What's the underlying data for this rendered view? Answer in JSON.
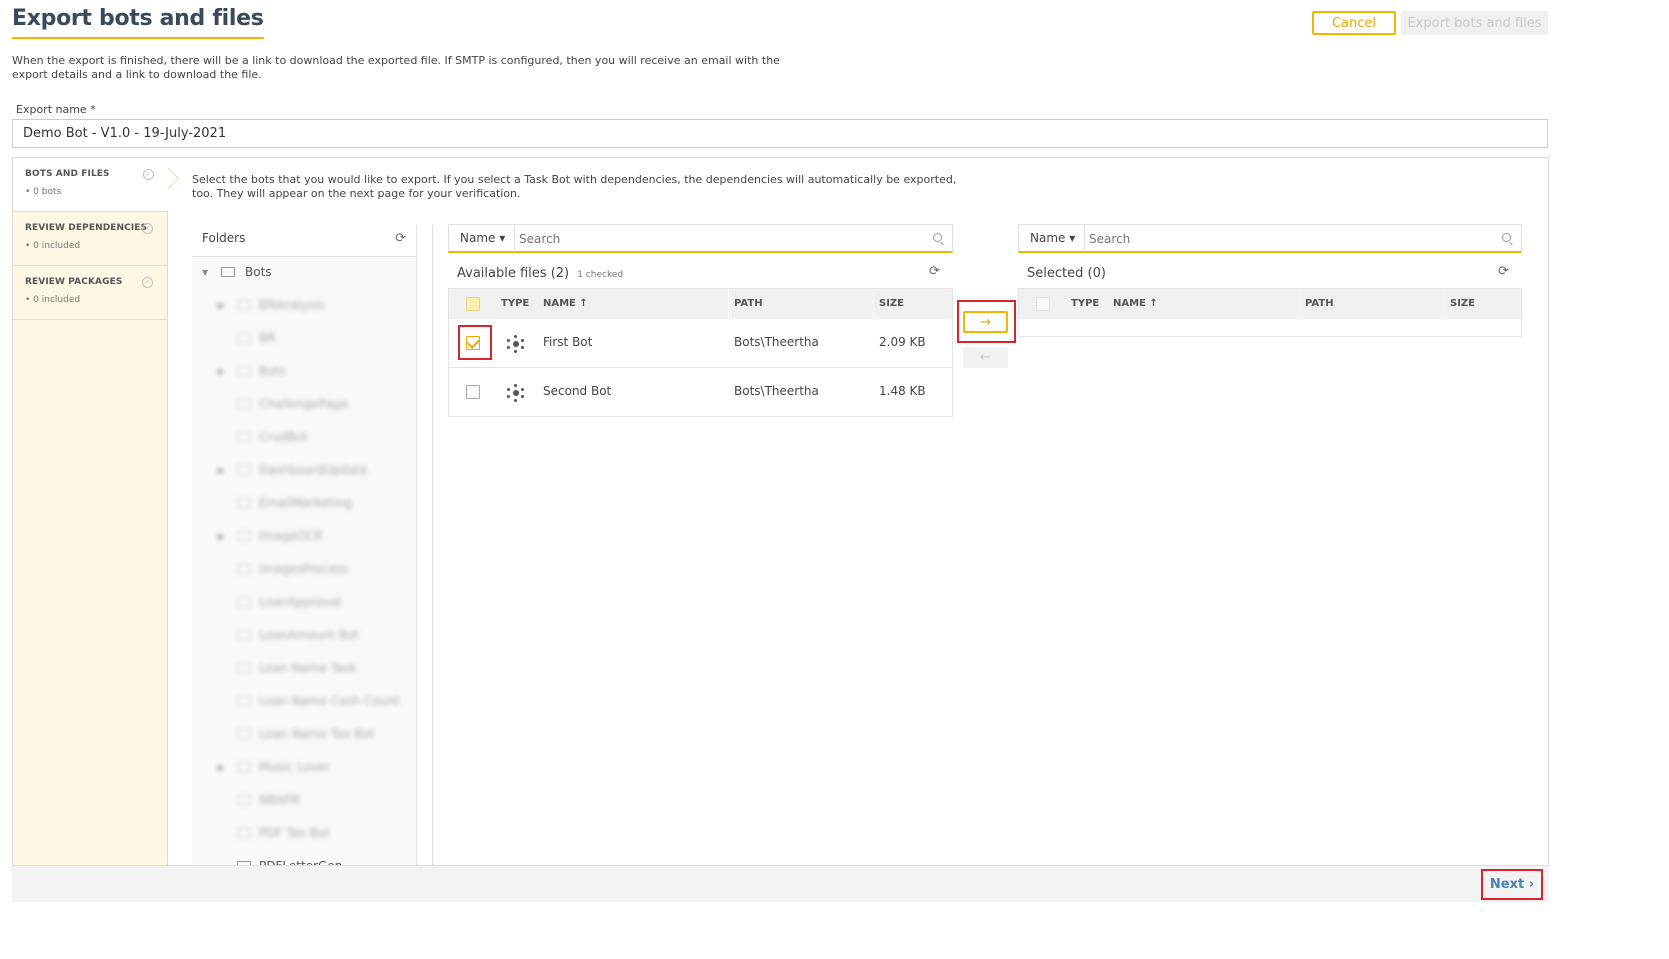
{
  "header": {
    "title": "Export bots and files",
    "description": "When the export is finished, there will be a link to download the exported file. If SMTP is configured, then you will receive an email with the export details and a link to download the file.",
    "cancel_label": "Cancel",
    "export_label": "Export bots and files"
  },
  "export_name": {
    "label": "Export name *",
    "value": "Demo Bot - V1.0 - 19-July-2021"
  },
  "steps": [
    {
      "title": "BOTS AND FILES",
      "sub": "• 0 bots"
    },
    {
      "title": "REVIEW DEPENDENCIES",
      "sub": "• 0 included"
    },
    {
      "title": "REVIEW PACKAGES",
      "sub": "• 0 included"
    }
  ],
  "hint": "Select the bots that you would like to export. If you select a Task Bot with dependencies, the dependencies will automatically be exported, too. They will appear on the next page for your verification.",
  "folders": {
    "title": "Folders",
    "root": "Bots",
    "children": [
      "BRAnalysis",
      "BR",
      "Bots",
      "ChallengePage",
      "CrudBot",
      "DashboardUpdate",
      "EmailMarketing",
      "ImageOCR",
      "ImagesProcess",
      "LoanApproval",
      "LoanAmount Bot",
      "Loan Name Task",
      "Loan Name Cash Count",
      "Loan Name Tax Bot",
      "Music Lover",
      "NBAPR",
      "PDF Tax Bot",
      "PDFLetterGen"
    ]
  },
  "available": {
    "sort_label": "Name",
    "search_placeholder": "Search",
    "title": "Available files",
    "count": "(2)",
    "checked_note": "1 checked",
    "columns": {
      "type": "TYPE",
      "name": "NAME ↑",
      "path": "PATH",
      "size": "SIZE"
    },
    "rows": [
      {
        "name": "First Bot",
        "path": "Bots\\Theertha",
        "size": "2.09 KB"
      },
      {
        "name": "Second Bot",
        "path": "Bots\\Theertha",
        "size": "1.48 KB"
      }
    ]
  },
  "selected": {
    "sort_label": "Name",
    "search_placeholder": "Search",
    "title": "Selected",
    "count": "(0)",
    "columns": {
      "type": "TYPE",
      "name": "NAME ↑",
      "path": "PATH",
      "size": "SIZE"
    }
  },
  "move": {
    "right": "→",
    "left": "←"
  },
  "footer": {
    "next_label": "Next ›"
  }
}
